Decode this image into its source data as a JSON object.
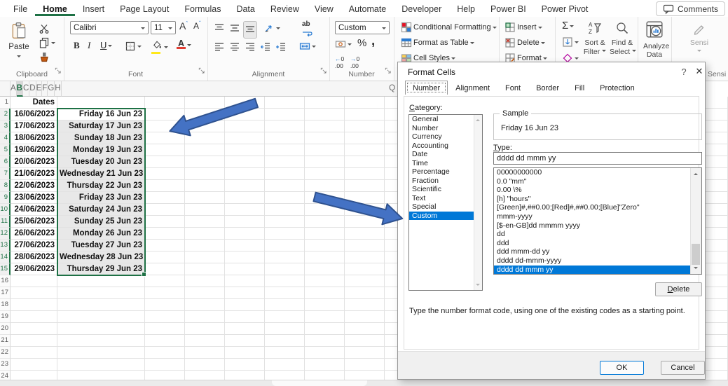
{
  "window": {
    "comments_label": "Comments"
  },
  "menu": {
    "items": [
      {
        "label": "File"
      },
      {
        "label": "Home",
        "selected": true
      },
      {
        "label": "Insert"
      },
      {
        "label": "Page Layout"
      },
      {
        "label": "Formulas"
      },
      {
        "label": "Data"
      },
      {
        "label": "Review"
      },
      {
        "label": "View"
      },
      {
        "label": "Automate"
      },
      {
        "label": "Developer"
      },
      {
        "label": "Help"
      },
      {
        "label": "Power BI"
      },
      {
        "label": "Power Pivot"
      }
    ]
  },
  "ribbon": {
    "clipboard": {
      "label": "Clipboard",
      "paste": "Paste"
    },
    "font": {
      "label": "Font",
      "font_name": "Calibri",
      "font_size": "11"
    },
    "alignment": {
      "label": "Alignment"
    },
    "number": {
      "label": "Number",
      "format_value": "Custom"
    },
    "styles": {
      "items": [
        {
          "label": "Conditional Formatting"
        },
        {
          "label": "Format as Table"
        },
        {
          "label": "Cell Styles"
        }
      ]
    },
    "cells": {
      "items": [
        {
          "label": "Insert"
        },
        {
          "label": "Delete"
        },
        {
          "label": "Format"
        }
      ]
    },
    "editing": {
      "sort_filter_line1": "Sort &",
      "sort_filter_line2": "Filter",
      "find_select_line1": "Find &",
      "find_select_line2": "Select"
    },
    "analyze_line1": "Analyze",
    "analyze_line2": "Data",
    "sensitivity_label": "Sensi",
    "sensitivity_group": "Sensi"
  },
  "sheet": {
    "columns": [
      {
        "label": "A"
      },
      {
        "label": "B",
        "selected": true
      },
      {
        "label": "C"
      },
      {
        "label": "D"
      },
      {
        "label": "E"
      },
      {
        "label": "F"
      },
      {
        "label": "G"
      },
      {
        "label": "H"
      }
    ],
    "right_column": "Q",
    "rows": [
      {
        "n": "1",
        "a": "Dates",
        "b": ""
      },
      {
        "n": "2",
        "a": "16/06/2023",
        "b": "Friday 16 Jun 23",
        "selected": true,
        "active": true
      },
      {
        "n": "3",
        "a": "17/06/2023",
        "b": "Saturday 17 Jun 23",
        "selected": true
      },
      {
        "n": "4",
        "a": "18/06/2023",
        "b": "Sunday 18 Jun 23",
        "selected": true
      },
      {
        "n": "5",
        "a": "19/06/2023",
        "b": "Monday 19 Jun 23",
        "selected": true
      },
      {
        "n": "6",
        "a": "20/06/2023",
        "b": "Tuesday 20 Jun 23",
        "selected": true
      },
      {
        "n": "7",
        "a": "21/06/2023",
        "b": "Wednesday 21 Jun 23",
        "selected": true
      },
      {
        "n": "8",
        "a": "22/06/2023",
        "b": "Thursday 22 Jun 23",
        "selected": true
      },
      {
        "n": "9",
        "a": "23/06/2023",
        "b": "Friday 23 Jun 23",
        "selected": true
      },
      {
        "n": "10",
        "a": "24/06/2023",
        "b": "Saturday 24 Jun 23",
        "selected": true
      },
      {
        "n": "11",
        "a": "25/06/2023",
        "b": "Sunday 25 Jun 23",
        "selected": true
      },
      {
        "n": "12",
        "a": "26/06/2023",
        "b": "Monday 26 Jun 23",
        "selected": true
      },
      {
        "n": "13",
        "a": "27/06/2023",
        "b": "Tuesday 27 Jun 23",
        "selected": true
      },
      {
        "n": "14",
        "a": "28/06/2023",
        "b": "Wednesday 28 Jun 23",
        "selected": true
      },
      {
        "n": "15",
        "a": "29/06/2023",
        "b": "Thursday 29 Jun 23",
        "selected": true
      },
      {
        "n": "16",
        "a": "",
        "b": ""
      },
      {
        "n": "17",
        "a": "",
        "b": ""
      },
      {
        "n": "18",
        "a": "",
        "b": ""
      },
      {
        "n": "19",
        "a": "",
        "b": ""
      },
      {
        "n": "20",
        "a": "",
        "b": ""
      },
      {
        "n": "21",
        "a": "",
        "b": ""
      },
      {
        "n": "22",
        "a": "",
        "b": ""
      },
      {
        "n": "23",
        "a": "",
        "b": ""
      },
      {
        "n": "24",
        "a": "",
        "b": ""
      }
    ]
  },
  "dialog": {
    "title": "Format Cells",
    "help_glyph": "?",
    "close_glyph": "✕",
    "tabs": [
      {
        "label": "Number",
        "selected": true
      },
      {
        "label": "Alignment"
      },
      {
        "label": "Font"
      },
      {
        "label": "Border"
      },
      {
        "label": "Fill"
      },
      {
        "label": "Protection"
      }
    ],
    "category_label": "Category:",
    "categories": [
      {
        "label": "General"
      },
      {
        "label": "Number"
      },
      {
        "label": "Currency"
      },
      {
        "label": "Accounting"
      },
      {
        "label": "Date"
      },
      {
        "label": "Time"
      },
      {
        "label": "Percentage"
      },
      {
        "label": "Fraction"
      },
      {
        "label": "Scientific"
      },
      {
        "label": "Text"
      },
      {
        "label": "Special"
      },
      {
        "label": "Custom",
        "selected": true
      }
    ],
    "sample_label": "Sample",
    "sample_value": "Friday 16 Jun 23",
    "type_label": "Type:",
    "type_value": "dddd dd mmm yy",
    "format_codes": [
      {
        "code": "00000000000"
      },
      {
        "code": "0.0 \"mm\""
      },
      {
        "code": "0.00 \\%"
      },
      {
        "code": "[h] \"hours\""
      },
      {
        "code": "[Green]#,##0.00;[Red]#,##0.00;[Blue]\"Zero\""
      },
      {
        "code": "mmm-yyyy"
      },
      {
        "code": "[$-en-GB]dd mmmm yyyy"
      },
      {
        "code": "dd"
      },
      {
        "code": "ddd"
      },
      {
        "code": "ddd mmm-dd yy"
      },
      {
        "code": "dddd dd-mmm-yyyy"
      },
      {
        "code": "dddd dd mmm yy",
        "selected": true
      }
    ],
    "delete_label": "Delete",
    "help_text": "Type the number format code, using one of the existing codes as a starting point.",
    "ok_label": "OK",
    "cancel_label": "Cancel"
  },
  "colors": {
    "accent_green": "#1E7145",
    "selection_blue": "#0078D7",
    "arrow_fill": "#4472C4",
    "arrow_outline": "#2F528F"
  }
}
